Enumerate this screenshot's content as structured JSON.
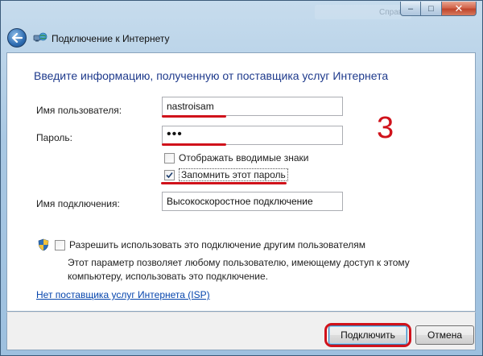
{
  "window": {
    "title": "Подключение к Интернету",
    "background_hint": "Справочные"
  },
  "caption": {
    "minimize": "–",
    "maximize": "□",
    "close": "✕"
  },
  "form": {
    "heading": "Введите информацию, полученную от поставщика услуг Интернета",
    "username_label": "Имя пользователя:",
    "username_value": "nastroisam",
    "password_label": "Пароль:",
    "password_value": "•••",
    "show_chars_label": "Отображать вводимые знаки",
    "show_chars_checked": false,
    "remember_label": "Запомнить этот пароль",
    "remember_checked": true,
    "connection_name_label": "Имя подключения:",
    "connection_name_value": "Высокоскоростное подключение",
    "allow_others_label": "Разрешить использовать это подключение другим пользователям",
    "allow_others_checked": false,
    "allow_others_desc": "Этот параметр позволяет любому пользователю, имеющему доступ к этому компьютеру, использовать это подключение.",
    "no_isp_link": "Нет поставщика услуг Интернета (ISP)"
  },
  "annotation": {
    "step_number": "3"
  },
  "footer": {
    "connect_button": "Подключить",
    "cancel_button": "Отмена"
  },
  "colors": {
    "heading": "#1e3a8c",
    "annotation": "#d0121b",
    "link": "#0645ad"
  }
}
